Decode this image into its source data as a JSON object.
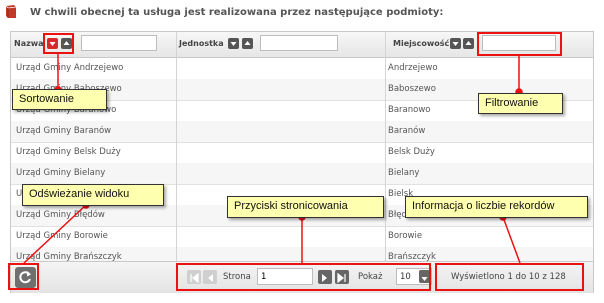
{
  "header": {
    "title": "W chwili obecnej ta usługa jest realizowana przez następujące podmioty:",
    "icon": "book-icon"
  },
  "grid": {
    "columns": [
      {
        "label": "Nazwa",
        "filter_value": ""
      },
      {
        "label": "Jednostka",
        "filter_value": ""
      },
      {
        "label": "Miejscowość",
        "filter_value": ""
      }
    ],
    "rows": [
      {
        "nazwa": "Urząd Gminy Andrzejewo",
        "jednostka": "",
        "miejscowosc": "Andrzejewo"
      },
      {
        "nazwa": "Urząd Gminy Baboszewo",
        "jednostka": "",
        "miejscowosc": "Baboszewo"
      },
      {
        "nazwa": "Urząd Gminy Baranowo",
        "jednostka": "",
        "miejscowosc": "Baranowo"
      },
      {
        "nazwa": "Urząd Gminy Baranów",
        "jednostka": "",
        "miejscowosc": "Baranów"
      },
      {
        "nazwa": "Urząd Gminy Belsk Duży",
        "jednostka": "",
        "miejscowosc": "Belsk Duży"
      },
      {
        "nazwa": "Urząd Gminy Bielany",
        "jednostka": "",
        "miejscowosc": "Bielany"
      },
      {
        "nazwa": "Urząd Gminy Bielsk",
        "jednostka": "",
        "miejscowosc": "Bielsk"
      },
      {
        "nazwa": "Urząd Gminy Błędów",
        "jednostka": "",
        "miejscowosc": "Błędów"
      },
      {
        "nazwa": "Urząd Gminy Borowie",
        "jednostka": "",
        "miejscowosc": "Borowie"
      },
      {
        "nazwa": "Urząd Gminy Brańszczyk",
        "jednostka": "",
        "miejscowosc": "Brańszczyk"
      }
    ]
  },
  "pager": {
    "page_label": "Strona",
    "page_value": "1",
    "show_label": "Pokaż",
    "page_size": "10",
    "records_info": "Wyświetlono 1 do 10 z 128"
  },
  "annotations": {
    "sort": "Sortowanie",
    "filter": "Filtrowanie",
    "refresh": "Odświeżanie widoku",
    "paging": "Przyciski stronicowania",
    "records": "Informacja o liczbie rekordów"
  },
  "colors": {
    "annotation_red": "#ee1111",
    "callout_bg": "#ffffb0",
    "sort_active": "#d9262b"
  }
}
